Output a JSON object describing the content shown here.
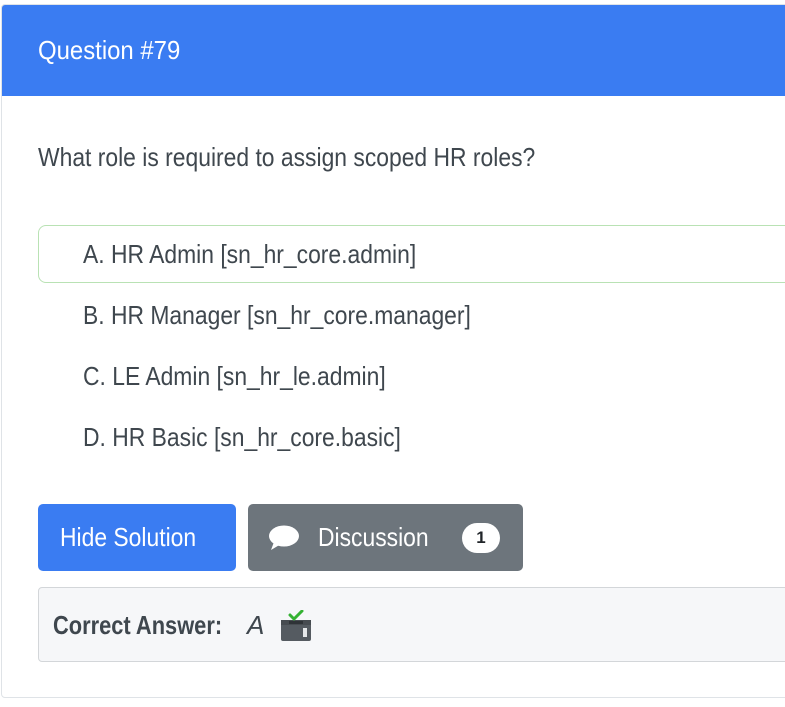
{
  "question": {
    "title": "Question #79",
    "text": "What role is required to assign scoped HR roles?"
  },
  "choices": [
    {
      "label": "A. HR Admin [sn_hr_core.admin]",
      "correct": true
    },
    {
      "label": "B. HR Manager [sn_hr_core.manager]",
      "correct": false
    },
    {
      "label": "C. LE Admin [sn_hr_le.admin]",
      "correct": false
    },
    {
      "label": "D. HR Basic [sn_hr_core.basic]",
      "correct": false
    }
  ],
  "buttons": {
    "hide_solution": "Hide Solution",
    "discussion": "Discussion",
    "discussion_count": "1"
  },
  "answer": {
    "label": "Correct Answer:",
    "value": "A",
    "vote_icon": "ballot-box-check-icon"
  },
  "colors": {
    "primary": "#3a7cf2",
    "secondary": "#6d757c",
    "correct_border": "#b9e2b4"
  }
}
